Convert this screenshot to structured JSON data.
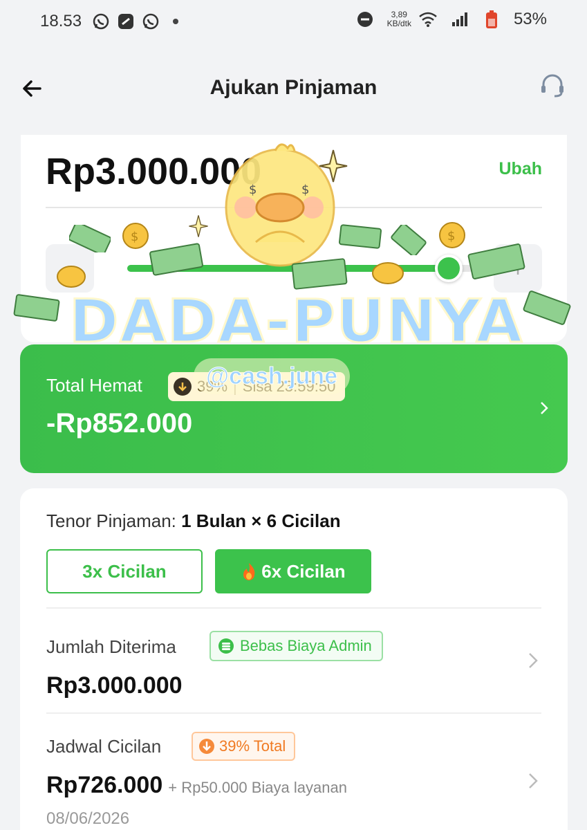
{
  "status_bar": {
    "time": "18.53",
    "net_speed_value": "3,89",
    "net_speed_unit": "KB/dtk",
    "battery": "53%"
  },
  "header": {
    "title": "Ajukan Pinjaman"
  },
  "loan_amount": {
    "value": "Rp3.000.000",
    "edit_label": "Ubah",
    "slider_fraction": 0.93
  },
  "savings": {
    "label": "Total Hemat",
    "badge_pct": "39%",
    "badge_timer": "Sisa 23:59:50",
    "value": "-Rp852.000"
  },
  "tenor": {
    "label": "Tenor Pinjaman:",
    "value": "1 Bulan × 6 Cicilan",
    "options": [
      {
        "label": "3x Cicilan",
        "selected": false
      },
      {
        "label": "6x Cicilan",
        "selected": true
      }
    ]
  },
  "received": {
    "label": "Jumlah Diterima",
    "tag": "Bebas Biaya Admin",
    "value": "Rp3.000.000"
  },
  "schedule": {
    "label": "Jadwal Cicilan",
    "tag": "39% Total",
    "value": "Rp726.000",
    "extra": "+ Rp50.000 Biaya layanan",
    "date": "08/06/2026"
  },
  "watermark": {
    "title": "DADA-PUNYA",
    "handle": "@cash.june"
  },
  "colors": {
    "primary_green": "#3cc24c",
    "accent_orange": "#f07a22"
  }
}
